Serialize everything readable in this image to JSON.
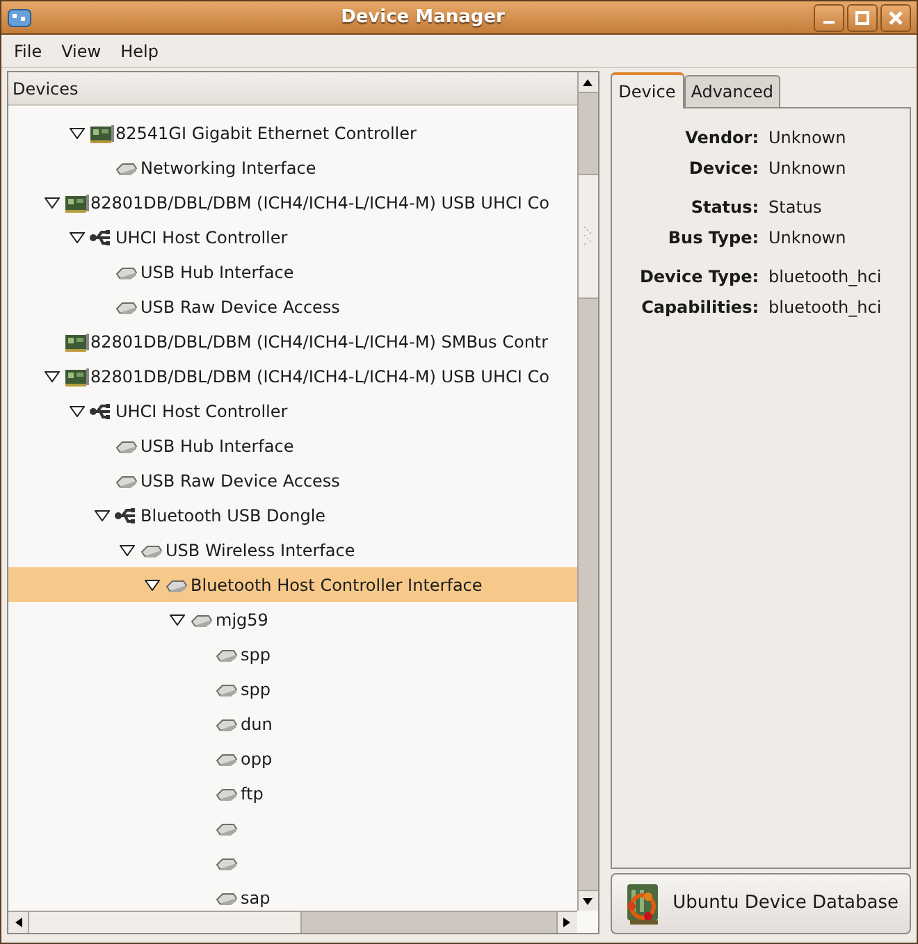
{
  "window": {
    "title": "Device Manager"
  },
  "menu": [
    "File",
    "View",
    "Help"
  ],
  "devices_header": "Devices",
  "tree": {
    "partial_branch": [
      {
        "label": "82541GI Gigabit Ethernet Controller",
        "kind": "card",
        "expanded": true,
        "selected": false,
        "children": [
          {
            "label": "Networking Interface",
            "kind": "device",
            "selected": false
          }
        ]
      }
    ],
    "items": [
      {
        "label": "82801DB/DBL/DBM (ICH4/ICH4-L/ICH4-M) USB UHCI Co",
        "kind": "card",
        "expanded": true,
        "selected": false,
        "children": [
          {
            "label": "UHCI Host Controller",
            "kind": "usb",
            "expanded": true,
            "selected": false,
            "children": [
              {
                "label": "USB Hub Interface",
                "kind": "device",
                "selected": false
              },
              {
                "label": "USB Raw Device Access",
                "kind": "device",
                "selected": false
              }
            ]
          }
        ]
      },
      {
        "label": "82801DB/DBL/DBM (ICH4/ICH4-L/ICH4-M) SMBus Contr",
        "kind": "card",
        "selected": false
      },
      {
        "label": "82801DB/DBL/DBM (ICH4/ICH4-L/ICH4-M) USB UHCI Co",
        "kind": "card",
        "expanded": true,
        "selected": false,
        "children": [
          {
            "label": "UHCI Host Controller",
            "kind": "usb",
            "expanded": true,
            "selected": false,
            "children": [
              {
                "label": "USB Hub Interface",
                "kind": "device",
                "selected": false
              },
              {
                "label": "USB Raw Device Access",
                "kind": "device",
                "selected": false
              },
              {
                "label": "Bluetooth USB Dongle",
                "kind": "usb",
                "expanded": true,
                "selected": false,
                "children": [
                  {
                    "label": "USB Wireless Interface",
                    "kind": "device",
                    "expanded": true,
                    "selected": false,
                    "children": [
                      {
                        "label": "Bluetooth Host Controller Interface",
                        "kind": "device",
                        "expanded": true,
                        "selected": true,
                        "children": [
                          {
                            "label": "mjg59",
                            "kind": "device",
                            "expanded": true,
                            "selected": false,
                            "children": [
                              {
                                "label": "spp",
                                "kind": "device",
                                "selected": false
                              },
                              {
                                "label": "spp",
                                "kind": "device",
                                "selected": false
                              },
                              {
                                "label": "dun",
                                "kind": "device",
                                "selected": false
                              },
                              {
                                "label": "opp",
                                "kind": "device",
                                "selected": false
                              },
                              {
                                "label": "ftp",
                                "kind": "device",
                                "selected": false
                              },
                              {
                                "kind": "device",
                                "selected": false
                              },
                              {
                                "kind": "device",
                                "selected": false
                              },
                              {
                                "label": "sap",
                                "kind": "device",
                                "selected": false
                              }
                            ]
                          }
                        ]
                      }
                    ]
                  }
                ]
              }
            ]
          }
        ]
      }
    ]
  },
  "tabs": [
    {
      "label": "Device",
      "selected": true
    },
    {
      "label": "Advanced",
      "selected": false
    }
  ],
  "property_groups": [
    [
      {
        "label": "Vendor:",
        "value": "Unknown"
      },
      {
        "label": "Device:",
        "value": "Unknown"
      }
    ],
    [
      {
        "label": "Status:",
        "value": "Status"
      },
      {
        "label": "Bus Type:",
        "value": "Unknown"
      }
    ],
    [
      {
        "label": "Device Type:",
        "value": "bluetooth_hci"
      },
      {
        "label": "Capabilities:",
        "value": "bluetooth_hci"
      }
    ]
  ],
  "database_button": "Ubuntu Device Database"
}
